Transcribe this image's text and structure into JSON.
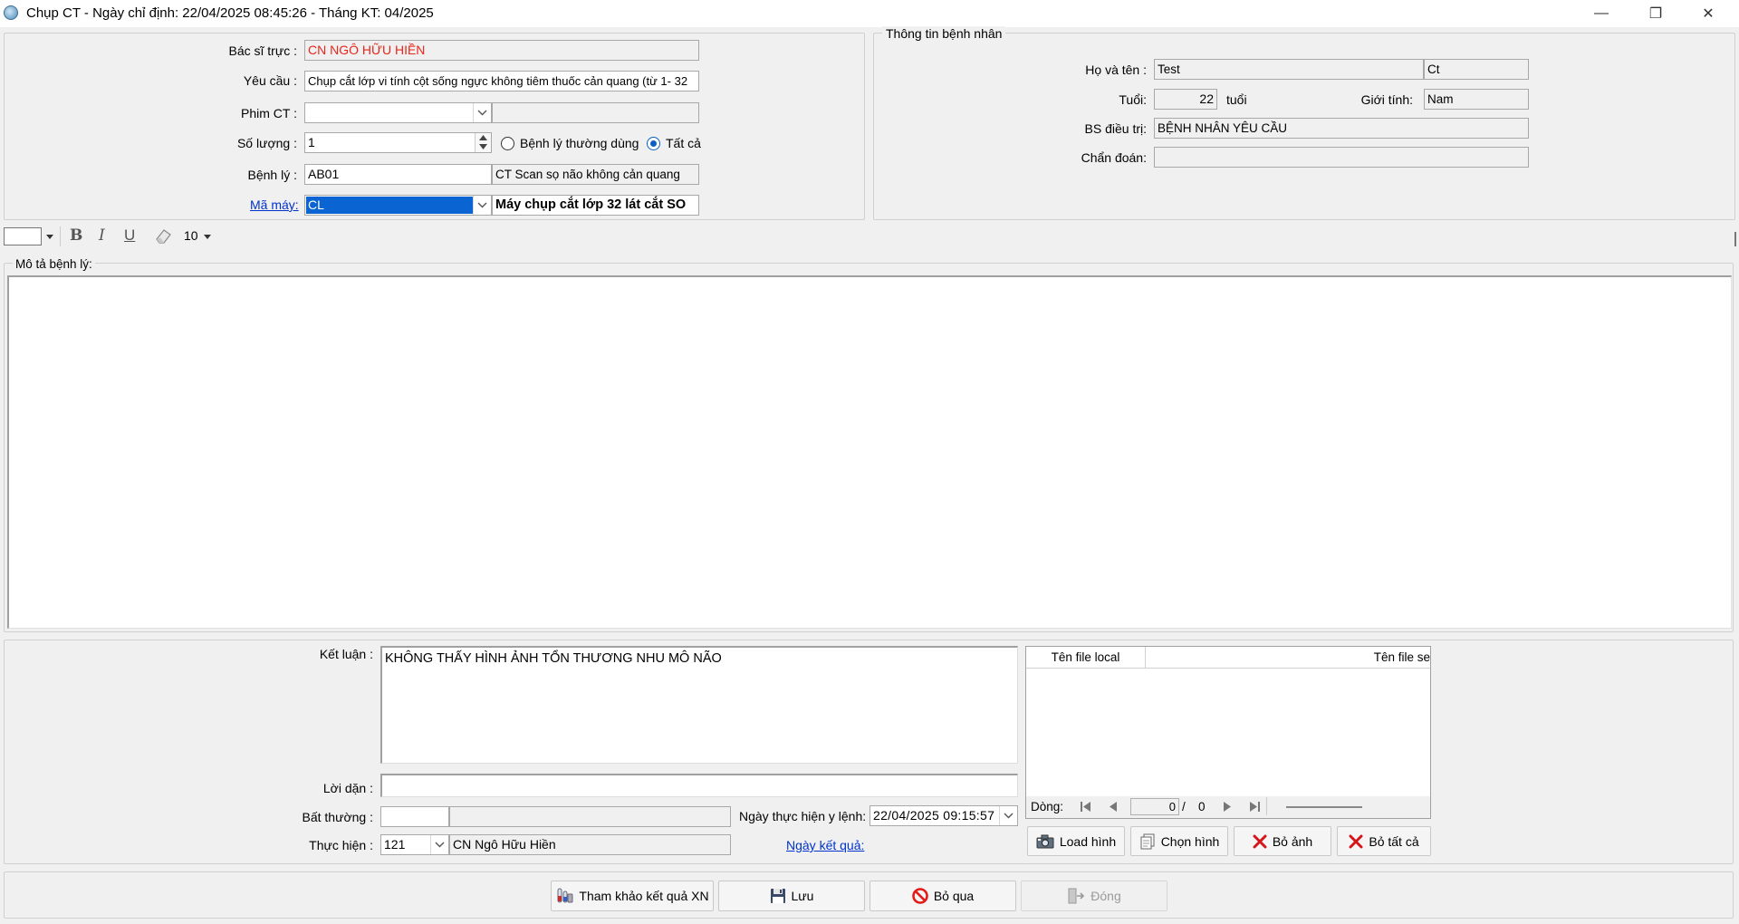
{
  "window": {
    "title": "Chụp CT - Ngày chỉ định: 22/04/2025 08:45:26 - Tháng KT: 04/2025",
    "minimize": "—",
    "restore": "❐",
    "close": "✕"
  },
  "order": {
    "bac_si_truc_label": "Bác sĩ trực :",
    "bac_si_truc": "CN NGÔ HỮU HIỀN",
    "yeu_cau_label": "Yêu cầu :",
    "yeu_cau": "Chụp cắt lớp vi tính cột sống ngực không tiêm thuốc cản quang (từ 1- 32",
    "phim_ct_label": "Phim CT :",
    "phim_ct": "",
    "phim_ct_desc": "",
    "so_luong_label": "Số lượng :",
    "so_luong": "1",
    "radio_common": "Bệnh lý thường dùng",
    "radio_all": "Tất cả",
    "benh_ly_label": "Bệnh lý :",
    "benh_ly_code": "AB01",
    "benh_ly_desc": "CT Scan sọ não không cản quang",
    "ma_may_label": "Mã máy:",
    "ma_may": "CL",
    "ma_may_desc": "Máy chụp cắt lớp 32 lát cắt SO"
  },
  "patient": {
    "group_title": "Thông tin bệnh nhân",
    "ho_ten_label": "Họ và tên :",
    "ho": "Test",
    "ten": "Ct",
    "tuoi_label": "Tuổi:",
    "tuoi": "22",
    "tuoi_unit": "tuổi",
    "gioi_tinh_label": "Giới tính:",
    "gioi_tinh": "Nam",
    "bs_dieu_tri_label": "BS điều trị:",
    "bs_dieu_tri": "BỆNH NHÂN YÊU CẦU",
    "chan_doan_label": "Chẩn đoán:",
    "chan_doan": ""
  },
  "toolbar": {
    "bold": "B",
    "italic": "I",
    "underline": "U",
    "font_size": "10"
  },
  "description": {
    "label": "Mô tả bệnh lý:",
    "text": ""
  },
  "result": {
    "ket_luan_label": "Kết luận :",
    "ket_luan": "KHÔNG THẤY HÌNH ẢNH TỔN THƯƠNG NHU MÔ NÃO",
    "loi_dan_label": "Lời dặn :",
    "loi_dan": "",
    "bat_thuong_label": "Bất thường :",
    "bat_thuong": "",
    "bat_thuong_desc": "",
    "thuc_hien_label": "Thực hiện :",
    "thuc_hien_code": "121",
    "thuc_hien_name": "CN Ngô Hữu Hiền",
    "ngay_thuc_hien_label": "Ngày thực hiện y lệnh:",
    "ngay_thuc_hien": "22/04/2025 09:15:57",
    "ngay_ket_qua_link": "Ngày kết quả:"
  },
  "files": {
    "col_local": "Tên file local",
    "col_server": "Tên file se",
    "nav_label": "Dòng:",
    "nav_current": "0",
    "nav_sep": "/",
    "nav_total": "0",
    "btn_load": "Load hình",
    "btn_choose": "Chọn hình",
    "btn_remove": "Bỏ ảnh",
    "btn_remove_all": "Bỏ tất cả"
  },
  "footer": {
    "btn_ref": "Tham khảo kết quả XN",
    "btn_save": "Lưu",
    "btn_skip": "Bỏ qua",
    "btn_close": "Đóng"
  },
  "colors": {
    "doctor_red": "#e8261c",
    "selection_blue": "#0a64d2",
    "link_blue": "#0033cc"
  }
}
